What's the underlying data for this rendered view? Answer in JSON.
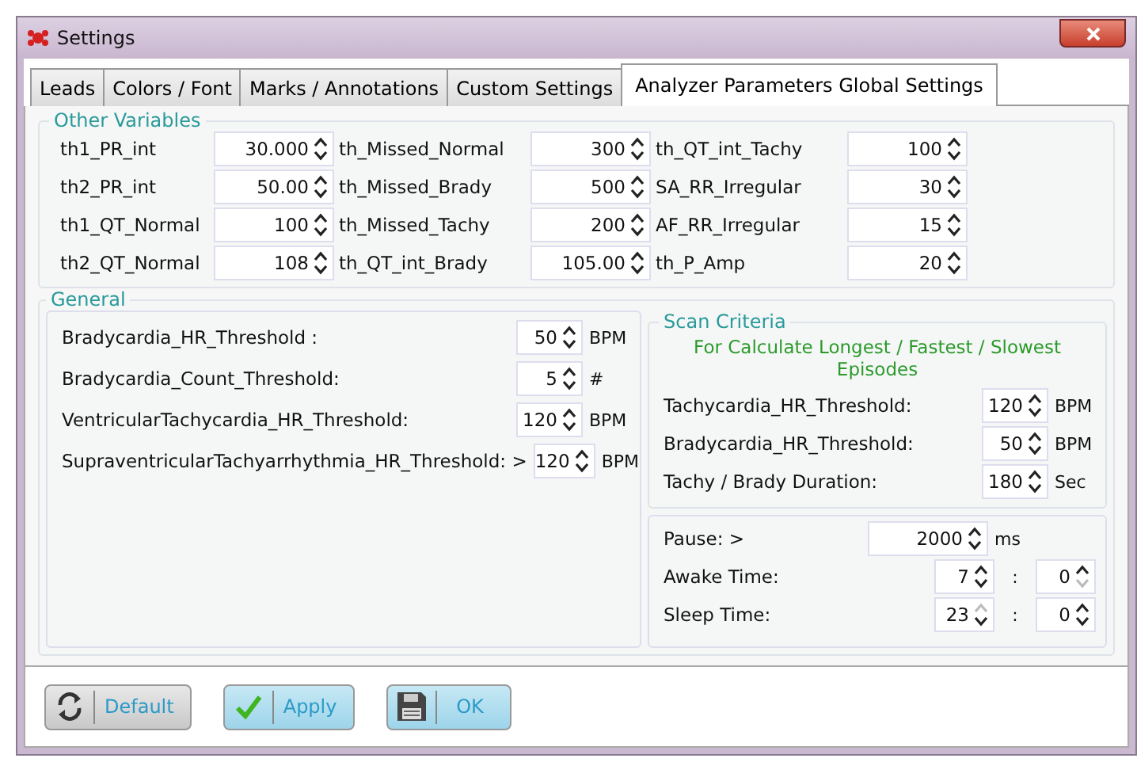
{
  "window": {
    "title": "Settings"
  },
  "tabs": [
    {
      "label": "Leads",
      "selected": false
    },
    {
      "label": "Colors / Font",
      "selected": false
    },
    {
      "label": "Marks / Annotations",
      "selected": false
    },
    {
      "label": "Custom Settings",
      "selected": false
    },
    {
      "label": "Analyzer Parameters Global Settings",
      "selected": true
    }
  ],
  "other_variables": {
    "title": "Other Variables",
    "fields": [
      {
        "label": "th1_PR_int",
        "value": "30.000"
      },
      {
        "label": "th_Missed_Normal",
        "value": "300"
      },
      {
        "label": "th_QT_int_Tachy",
        "value": "100"
      },
      {
        "label": "th2_PR_int",
        "value": "50.00"
      },
      {
        "label": "th_Missed_Brady",
        "value": "500"
      },
      {
        "label": "SA_RR_Irregular",
        "value": "30"
      },
      {
        "label": "th1_QT_Normal",
        "value": "100"
      },
      {
        "label": "th_Missed_Tachy",
        "value": "200"
      },
      {
        "label": "AF_RR_Irregular",
        "value": "15"
      },
      {
        "label": "th2_QT_Normal",
        "value": "108"
      },
      {
        "label": "th_QT_int_Brady",
        "value": "105.00"
      },
      {
        "label": "th_P_Amp",
        "value": "20"
      }
    ]
  },
  "general": {
    "title": "General",
    "fields": [
      {
        "label": "Bradycardia_HR_Threshold :",
        "value": "50",
        "unit": "BPM"
      },
      {
        "label": "Bradycardia_Count_Threshold:",
        "value": "5",
        "unit": "#"
      },
      {
        "label": "VentricularTachycardia_HR_Threshold:",
        "value": "120",
        "unit": "BPM"
      },
      {
        "label": "SupraventricularTachyarrhythmia_HR_Threshold: >",
        "value": "120",
        "unit": "BPM"
      }
    ]
  },
  "scan_criteria": {
    "title": "Scan Criteria",
    "note": "For Calculate Longest / Fastest / Slowest Episodes",
    "fields": [
      {
        "label": "Tachycardia_HR_Threshold:",
        "value": "120",
        "unit": "BPM"
      },
      {
        "label": "Bradycardia_HR_Threshold:",
        "value": "50",
        "unit": "BPM"
      },
      {
        "label": "Tachy / Brady Duration:",
        "value": "180",
        "unit": "Sec"
      }
    ]
  },
  "pause": {
    "label": "Pause: >",
    "value": "2000",
    "unit": "ms"
  },
  "times": [
    {
      "label": "Awake Time:",
      "separator": ":",
      "hours": {
        "value": "7",
        "up_disabled": false,
        "down_disabled": false
      },
      "minutes": {
        "value": "0",
        "up_disabled": false,
        "down_disabled": true
      }
    },
    {
      "label": "Sleep Time:",
      "separator": ":",
      "hours": {
        "value": "23",
        "up_disabled": true,
        "down_disabled": false
      },
      "minutes": {
        "value": "0",
        "up_disabled": false,
        "down_disabled": false
      }
    }
  ],
  "buttons": [
    {
      "label": "Default",
      "kind": "refresh",
      "highlighted": false
    },
    {
      "label": "Apply",
      "kind": "check",
      "highlighted": true
    },
    {
      "label": "OK",
      "kind": "save",
      "highlighted": true
    }
  ]
}
